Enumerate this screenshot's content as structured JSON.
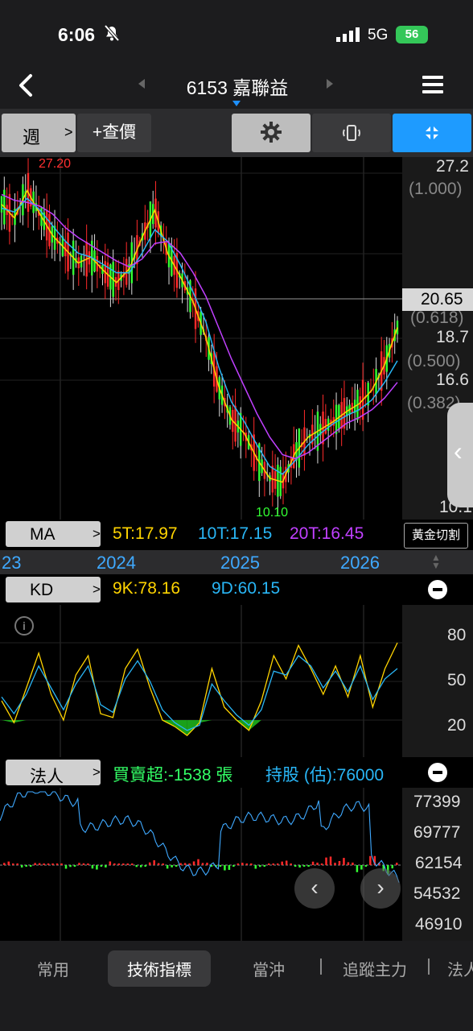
{
  "status": {
    "time": "6:06",
    "network": "5G",
    "battery": "56"
  },
  "nav": {
    "title": "6153 嘉聯益"
  },
  "toolbar": {
    "period": "週",
    "quote_label": "+查價"
  },
  "main_chart": {
    "y_labels": [
      "27.2",
      "(1.000)",
      "20.65",
      "(0.618)",
      "18.7",
      "(0.500)",
      "16.6",
      "(0.382)",
      "10.1"
    ],
    "high_label": "27.20",
    "low_label": "10.10",
    "current_price": "20.65",
    "colors": {
      "up": "#ff2a2a",
      "down": "#33ff33",
      "ma5": "#ffd400",
      "ma10": "#29b6f6",
      "ma20": "#c040ff"
    }
  },
  "ma": {
    "label": "MA",
    "ma5": "5T:17.97",
    "ma10": "10T:17.15",
    "ma20": "20T:16.45",
    "golden_label": "黃金切割"
  },
  "years": [
    "23",
    "2024",
    "2025",
    "2026"
  ],
  "kd": {
    "label": "KD",
    "k_value": "9K:78.16",
    "d_value": "9D:60.15",
    "y_labels": [
      "80",
      "50",
      "20"
    ]
  },
  "inst": {
    "label": "法人",
    "net_label": "買賣超:-1538 張",
    "holding_label": "持股 (估):76000",
    "y_labels": [
      "77399",
      "69777",
      "62154",
      "54532",
      "46910"
    ]
  },
  "tabs": [
    "常用",
    "技術指標",
    "當沖",
    "追蹤主力",
    "法人"
  ],
  "chart_data": [
    {
      "type": "line",
      "title": "",
      "series": [
        {
          "name": "5T",
          "values": [
            25.5,
            24.8,
            26.2,
            25.0,
            23.9,
            23.2,
            22.5,
            22.8,
            22.1,
            21.5,
            22.2,
            23.8,
            25.2,
            23.0,
            21.8,
            20.5,
            18.7,
            16.2,
            14.5,
            13.8,
            12.5,
            11.5,
            11.3,
            12.8,
            13.6,
            14.0,
            14.4,
            14.9,
            15.3,
            16.0,
            17.3,
            19.2
          ]
        },
        {
          "name": "10T",
          "values": [
            25.3,
            25.1,
            25.8,
            25.2,
            24.4,
            23.6,
            23.0,
            22.8,
            22.4,
            22.0,
            22.0,
            23.0,
            24.2,
            23.6,
            22.4,
            21.0,
            19.5,
            17.2,
            15.4,
            14.4,
            13.2,
            12.1,
            11.7,
            12.4,
            13.2,
            13.8,
            14.3,
            14.7,
            15.0,
            15.5,
            16.4,
            17.5
          ]
        },
        {
          "name": "20T",
          "values": [
            26.0,
            25.7,
            25.6,
            25.4,
            25.0,
            24.3,
            23.8,
            23.4,
            23.0,
            22.6,
            22.3,
            22.7,
            23.5,
            23.6,
            23.0,
            22.0,
            20.8,
            19.2,
            17.6,
            16.2,
            14.8,
            13.6,
            12.7,
            12.5,
            12.8,
            13.3,
            13.8,
            14.3,
            14.6,
            15.0,
            15.6,
            16.4
          ]
        }
      ]
    },
    {
      "type": "line",
      "series": [
        {
          "name": "9K",
          "values": [
            35,
            18,
            45,
            72,
            40,
            20,
            55,
            70,
            25,
            22,
            60,
            75,
            45,
            20,
            15,
            8,
            18,
            60,
            30,
            20,
            12,
            35,
            70,
            52,
            78,
            60,
            40,
            62,
            38,
            70,
            30,
            60,
            80
          ]
        },
        {
          "name": "9D",
          "values": [
            38,
            25,
            40,
            62,
            45,
            28,
            48,
            62,
            32,
            26,
            52,
            66,
            50,
            28,
            18,
            12,
            16,
            48,
            35,
            24,
            16,
            28,
            58,
            55,
            70,
            62,
            45,
            58,
            42,
            62,
            36,
            52,
            60
          ]
        }
      ]
    },
    {
      "type": "bar",
      "series": [
        {
          "name": "買賣超",
          "values": [
            3,
            -2,
            2,
            1,
            -3,
            2,
            -4,
            3,
            1,
            -2,
            4,
            -3,
            2,
            5,
            -1,
            -5,
            2,
            -3,
            1,
            4,
            -2,
            3,
            8,
            6,
            -6,
            9,
            -8,
            5,
            -1538
          ]
        }
      ]
    }
  ]
}
